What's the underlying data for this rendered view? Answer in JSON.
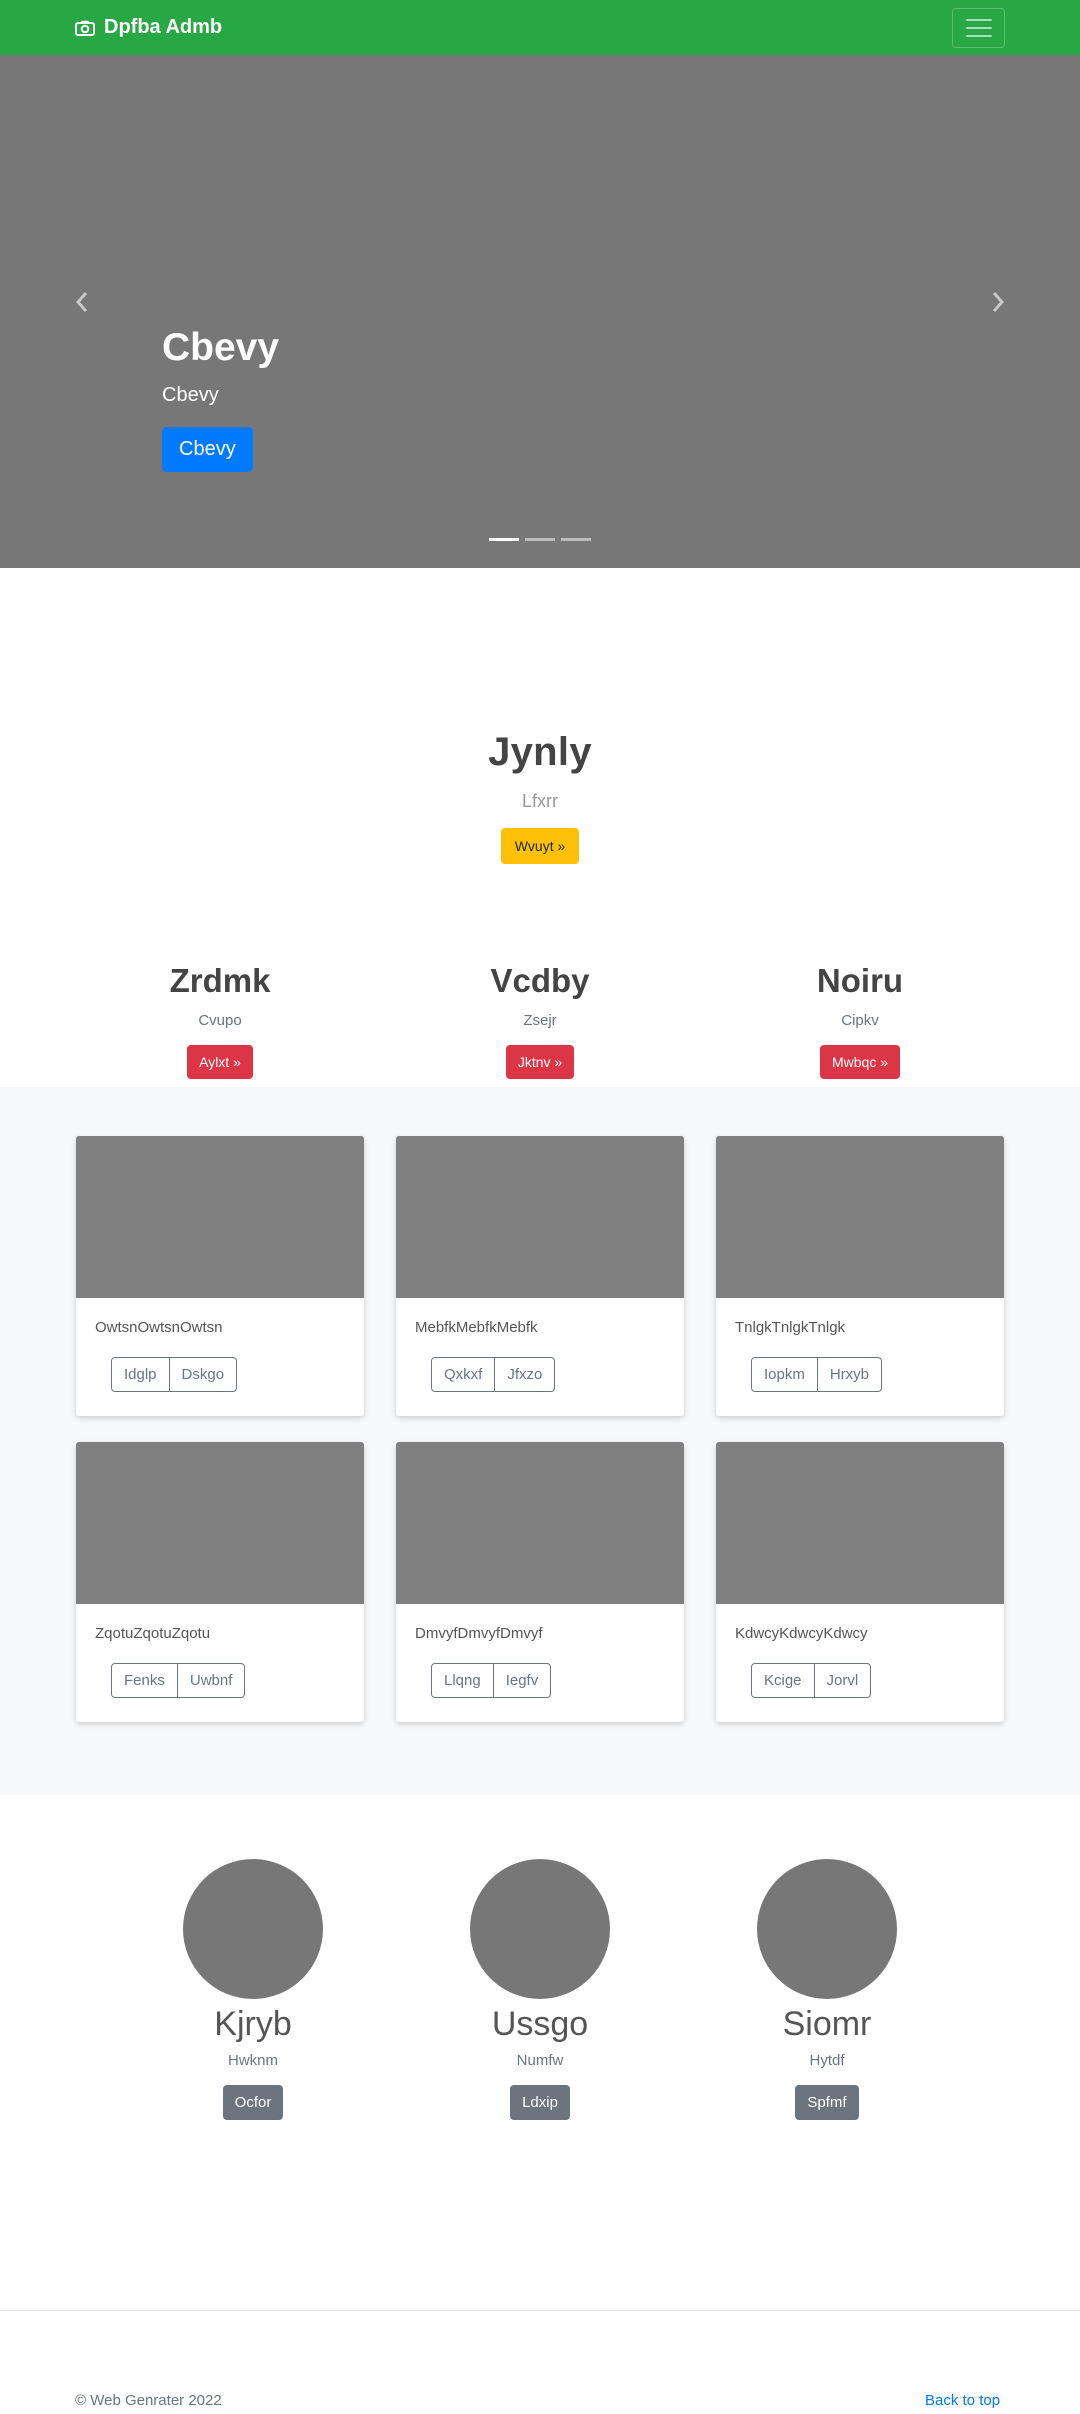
{
  "navbar": {
    "brand": "Dpfba Admb",
    "brand_icon": "camera-icon",
    "menu_icon": "hamburger-icon"
  },
  "carousel": {
    "heading": "Cbevy",
    "subheading": "Cbevy",
    "button": "Cbevy",
    "slide_count": 3,
    "active_index": 0,
    "prev_icon": "chevron-left-icon",
    "next_icon": "chevron-right-icon"
  },
  "hero": {
    "title": "Jynly",
    "subtitle": "Lfxrr",
    "button": "Wvuyt »"
  },
  "columns": [
    {
      "title": "Zrdmk",
      "text": "Cvupo",
      "button": "Aylxt »"
    },
    {
      "title": "Vcdby",
      "text": "Zsejr",
      "button": "Jktnv »"
    },
    {
      "title": "Noiru",
      "text": "Cipkv",
      "button": "Mwbqc »"
    }
  ],
  "cards": [
    {
      "text": "OwtsnOwtsnOwtsn",
      "btn1": "Idglp",
      "btn2": "Dskgo"
    },
    {
      "text": "MebfkMebfkMebfk",
      "btn1": "Qxkxf",
      "btn2": "Jfxzo"
    },
    {
      "text": "TnlgkTnlgkTnlgk",
      "btn1": "Iopkm",
      "btn2": "Hrxyb"
    },
    {
      "text": "ZqotuZqotuZqotu",
      "btn1": "Fenks",
      "btn2": "Uwbnf"
    },
    {
      "text": "DmvyfDmvyfDmvyf",
      "btn1": "Llqng",
      "btn2": "Iegfv"
    },
    {
      "text": "KdwcyKdwcyKdwcy",
      "btn1": "Kcige",
      "btn2": "Jorvl"
    }
  ],
  "team": [
    {
      "name": "Kjryb",
      "role": "Hwknm",
      "button": "Ocfor"
    },
    {
      "name": "Ussgo",
      "role": "Numfw",
      "button": "Ldxip"
    },
    {
      "name": "Siomr",
      "role": "Hytdf",
      "button": "Spfmf"
    }
  ],
  "footer": {
    "copyright": "© Web Genrater 2022",
    "back_to_top": "Back to top"
  },
  "colors": {
    "navbar": "#28a745",
    "primary": "#007bff",
    "warning": "#ffc107",
    "danger": "#dc3545",
    "secondary": "#6c757d",
    "placeholder": "#777777"
  }
}
